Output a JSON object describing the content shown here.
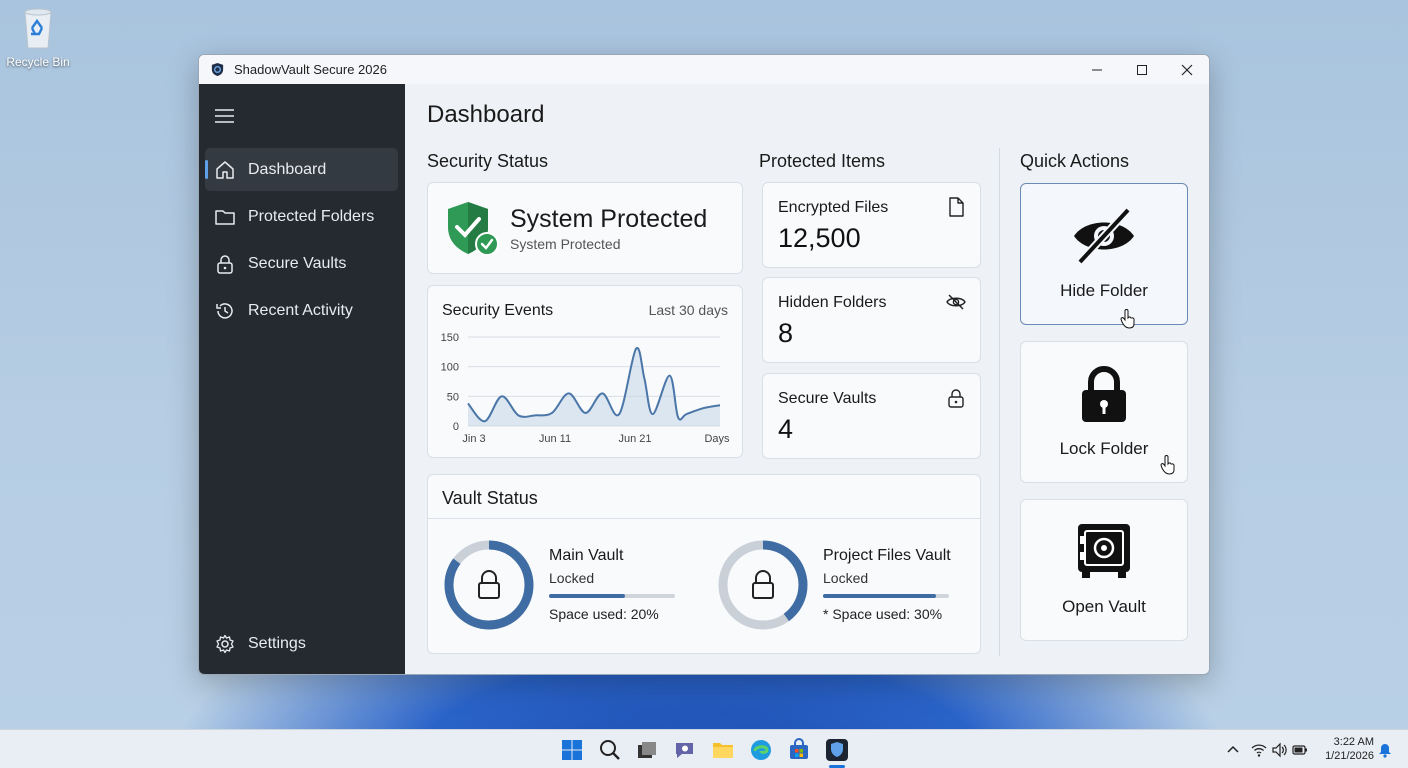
{
  "desktop": {
    "recycle_bin_label": "Recycle Bin"
  },
  "window": {
    "title": "ShadowVault Secure 2026"
  },
  "sidebar": {
    "items": [
      {
        "label": "Dashboard",
        "icon": "home-icon",
        "active": true
      },
      {
        "label": "Protected Folders",
        "icon": "folder-icon"
      },
      {
        "label": "Secure Vaults",
        "icon": "lock-icon"
      },
      {
        "label": "Recent Activity",
        "icon": "history-icon"
      }
    ],
    "settings_label": "Settings"
  },
  "main": {
    "page_title": "Dashboard",
    "security_status": {
      "section_title": "Security Status",
      "headline": "System Protected",
      "subtext": "System Protected"
    },
    "security_events": {
      "title": "Security Events",
      "range": "Last 30 days"
    },
    "protected_items": {
      "section_title": "Protected Items",
      "stats": [
        {
          "label": "Encrypted Files",
          "value": "12,500",
          "icon": "file-icon"
        },
        {
          "label": "Hidden Folders",
          "value": "8",
          "icon": "eye-off-icon"
        },
        {
          "label": "Secure Vaults",
          "value": "4",
          "icon": "lock-icon"
        }
      ]
    },
    "quick_actions": {
      "section_title": "Quick Actions",
      "actions": [
        {
          "label": "Hide Folder",
          "icon": "eye-off-icon"
        },
        {
          "label": "Lock Folder",
          "icon": "padlock-icon"
        },
        {
          "label": "Open Vault",
          "icon": "safe-icon"
        }
      ]
    },
    "vault_status": {
      "title": "Vault Status",
      "vaults": [
        {
          "name": "Main Vault",
          "state": "Locked",
          "space_text": "Space used: 20%",
          "used_fraction": 0.2,
          "ring_fraction": 0.85
        },
        {
          "name": "Project Files Vault",
          "state": "Locked",
          "space_text": "* Space used: 30%",
          "used_fraction": 0.3,
          "ring_fraction": 0.4
        }
      ]
    }
  },
  "chart_data": {
    "type": "area",
    "title": "Security Events",
    "ylim": [
      0,
      150
    ],
    "yticks": [
      0,
      50,
      100,
      150
    ],
    "xtick_labels": [
      "Jin 3",
      "Jun 11",
      "Jun 21",
      "Days"
    ],
    "x": [
      0,
      2,
      4,
      6,
      8,
      10,
      12,
      14,
      16,
      18,
      20,
      21,
      22,
      24,
      25,
      26,
      28,
      30
    ],
    "values": [
      38,
      8,
      50,
      18,
      18,
      22,
      55,
      22,
      55,
      20,
      130,
      80,
      20,
      85,
      15,
      20,
      30,
      35
    ],
    "grid": true,
    "colors": {
      "line": "#4a76a8",
      "fill": "#c9d8ea"
    }
  },
  "taskbar": {
    "time": "3:22 AM",
    "date": "1/21/2026"
  }
}
